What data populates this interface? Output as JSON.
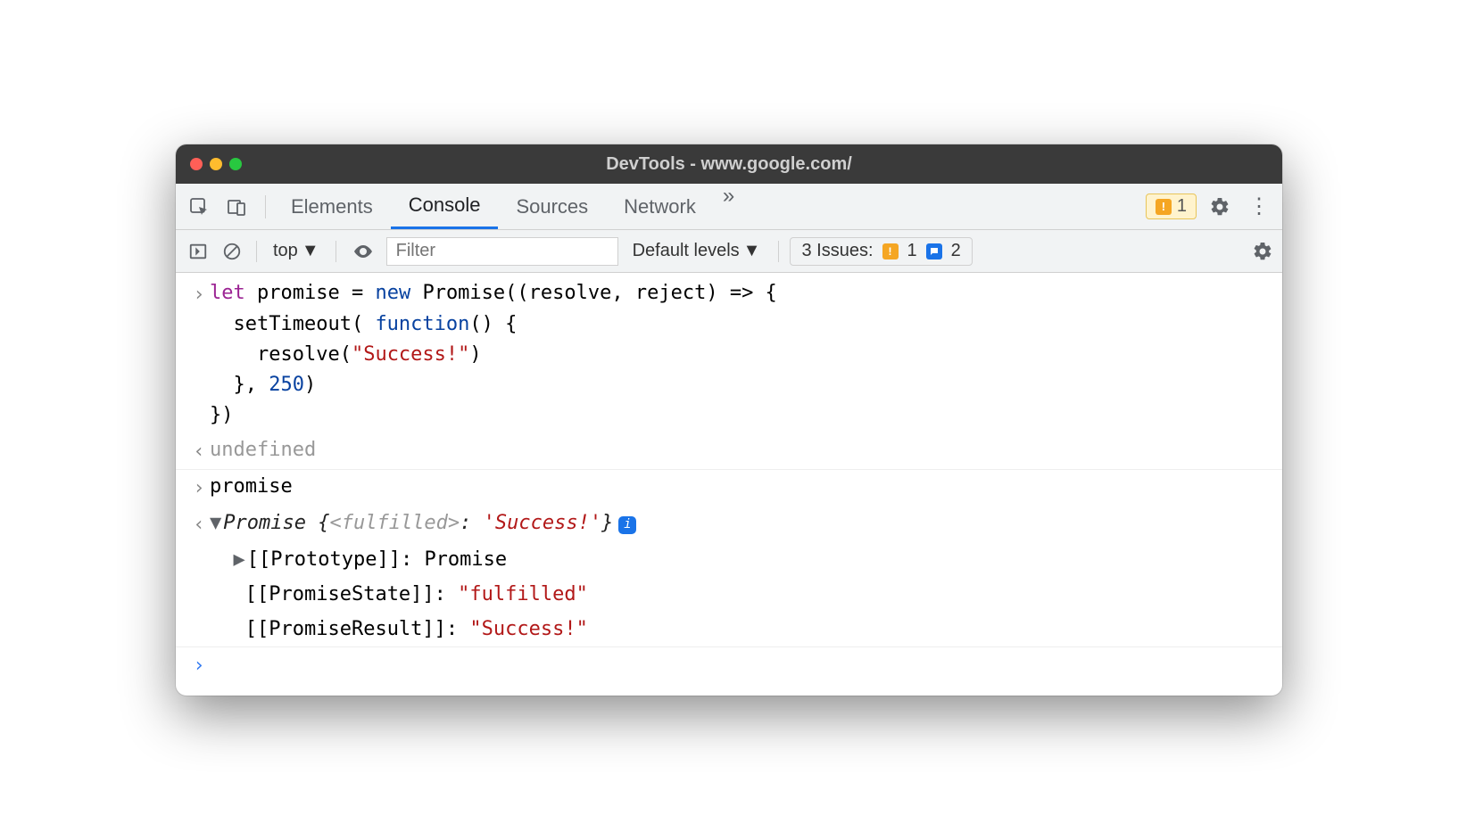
{
  "window": {
    "title": "DevTools - www.google.com/"
  },
  "tabs": {
    "items": [
      "Elements",
      "Console",
      "Sources",
      "Network"
    ],
    "active": "Console",
    "overflow": "»"
  },
  "tabbar": {
    "warn_count": "1"
  },
  "toolbar": {
    "context": "top",
    "filter_placeholder": "Filter",
    "levels": "Default levels",
    "issues_label": "3 Issues:",
    "issues_warn": "1",
    "issues_info": "2"
  },
  "console": {
    "line1a": "let",
    "line1b": " promise = ",
    "line1c": "new",
    "line1d": " Promise((resolve, reject) => {",
    "line2a": "  setTimeout( ",
    "line2b": "function",
    "line2c": "() {",
    "line3a": "    resolve(",
    "line3b": "\"Success!\"",
    "line3c": ")",
    "line4a": "  }, ",
    "line4b": "250",
    "line4c": ")",
    "line5": "})",
    "result1": "undefined",
    "input2": "promise",
    "obj_head_a": "Promise {",
    "obj_head_b": "<fulfilled>",
    "obj_head_c": ": ",
    "obj_head_d": "'Success!'",
    "obj_head_e": "}",
    "proto_key": "[[Prototype]]",
    "proto_val": "Promise",
    "state_key": "[[PromiseState]]",
    "state_val": "\"fulfilled\"",
    "result_key": "[[PromiseResult]]",
    "result_val": "\"Success!\""
  }
}
